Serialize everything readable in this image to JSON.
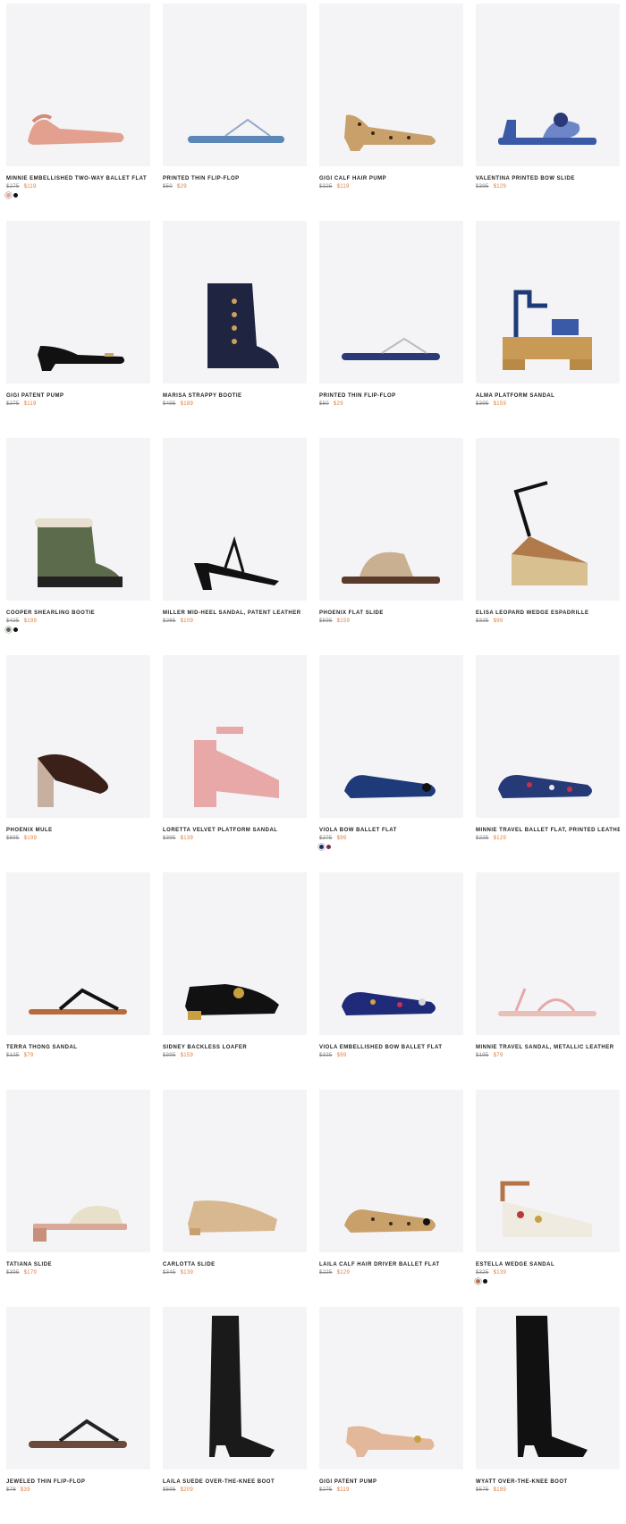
{
  "colors": {
    "sale_price": "#e07d3a",
    "original_price": "#888888",
    "tile_background": "#f4f4f6"
  },
  "products": [
    {
      "name": "MINNIE EMBELLISHED TWO-WAY BALLET FLAT",
      "original_price": "$275",
      "sale_price": "$119",
      "swatches": [
        "#e9a593",
        "#111111"
      ],
      "icon": "pink-ballet-flat-image"
    },
    {
      "name": "PRINTED THIN FLIP-FLOP",
      "original_price": "$50",
      "sale_price": "$29",
      "swatches": [],
      "icon": "blue-flip-flop-image"
    },
    {
      "name": "GIGI CALF HAIR PUMP",
      "original_price": "$325",
      "sale_price": "$119",
      "swatches": [],
      "icon": "leopard-pump-image"
    },
    {
      "name": "VALENTINA PRINTED BOW SLIDE",
      "original_price": "$395",
      "sale_price": "$129",
      "swatches": [],
      "icon": "printed-bow-slide-image"
    },
    {
      "name": "GIGI PATENT PUMP",
      "original_price": "$275",
      "sale_price": "$119",
      "swatches": [],
      "icon": "black-patent-pump-image"
    },
    {
      "name": "MARISA STRAPPY BOOTIE",
      "original_price": "$495",
      "sale_price": "$189",
      "swatches": [],
      "icon": "navy-strappy-bootie-image"
    },
    {
      "name": "PRINTED THIN FLIP-FLOP",
      "original_price": "$50",
      "sale_price": "$29",
      "swatches": [],
      "icon": "navy-flip-flop-image"
    },
    {
      "name": "ALMA PLATFORM SANDAL",
      "original_price": "$395",
      "sale_price": "$159",
      "swatches": [],
      "icon": "wood-platform-sandal-image"
    },
    {
      "name": "COOPER SHEARLING BOOTIE",
      "original_price": "$425",
      "sale_price": "$199",
      "swatches": [
        "#556b4e",
        "#111111"
      ],
      "icon": "green-shearling-bootie-image"
    },
    {
      "name": "MILLER MID-HEEL SANDAL, PATENT LEATHER",
      "original_price": "$265",
      "sale_price": "$109",
      "swatches": [],
      "icon": "black-mid-heel-sandal-image"
    },
    {
      "name": "PHOENIX FLAT SLIDE",
      "original_price": "$595",
      "sale_price": "$159",
      "swatches": [],
      "icon": "fur-flat-slide-image"
    },
    {
      "name": "ELISA LEOPARD WEDGE ESPADRILLE",
      "original_price": "$325",
      "sale_price": "$99",
      "swatches": [],
      "icon": "leopard-wedge-espadrille-image"
    },
    {
      "name": "PHOENIX MULE",
      "original_price": "$695",
      "sale_price": "$199",
      "swatches": [],
      "icon": "brown-mule-image"
    },
    {
      "name": "LORETTA VELVET PLATFORM SANDAL",
      "original_price": "$395",
      "sale_price": "$139",
      "swatches": [],
      "icon": "pink-velvet-platform-image"
    },
    {
      "name": "VIOLA BOW BALLET FLAT",
      "original_price": "$275",
      "sale_price": "$99",
      "swatches": [
        "#1e2a66",
        "#7d2a52"
      ],
      "icon": "navy-bow-ballet-flat-image"
    },
    {
      "name": "MINNIE TRAVEL BALLET FLAT, PRINTED LEATHER",
      "original_price": "$225",
      "sale_price": "$129",
      "swatches": [],
      "icon": "printed-travel-ballet-flat-image"
    },
    {
      "name": "TERRA THONG SANDAL",
      "original_price": "$125",
      "sale_price": "$79",
      "swatches": [],
      "icon": "thong-sandal-image"
    },
    {
      "name": "SIDNEY BACKLESS LOAFER",
      "original_price": "$395",
      "sale_price": "$159",
      "swatches": [],
      "icon": "black-backless-loafer-image"
    },
    {
      "name": "VIOLA EMBELLISHED BOW BALLET FLAT",
      "original_price": "$325",
      "sale_price": "$99",
      "swatches": [],
      "icon": "embellished-ballet-flat-image"
    },
    {
      "name": "MINNIE TRAVEL SANDAL, METALLIC LEATHER",
      "original_price": "$195",
      "sale_price": "$79",
      "swatches": [],
      "icon": "metallic-travel-sandal-image"
    },
    {
      "name": "TATIANA SLIDE",
      "original_price": "$395",
      "sale_price": "$179",
      "swatches": [],
      "icon": "woven-slide-image"
    },
    {
      "name": "CARLOTTA SLIDE",
      "original_price": "$345",
      "sale_price": "$139",
      "swatches": [],
      "icon": "brocade-slide-image"
    },
    {
      "name": "LAILA CALF HAIR DRIVER BALLET FLAT",
      "original_price": "$225",
      "sale_price": "$129",
      "swatches": [],
      "icon": "leopard-driver-flat-image"
    },
    {
      "name": "ESTELLA WEDGE SANDAL",
      "original_price": "$325",
      "sale_price": "$139",
      "swatches": [
        "#b5734a",
        "#111111"
      ],
      "icon": "studded-wedge-sandal-image"
    },
    {
      "name": "JEWELED THIN FLIP-FLOP",
      "original_price": "$78",
      "sale_price": "$39",
      "swatches": [],
      "icon": "jeweled-flip-flop-image"
    },
    {
      "name": "LAILA SUEDE OVER-THE-KNEE BOOT",
      "original_price": "$595",
      "sale_price": "$209",
      "swatches": [],
      "icon": "black-suede-otk-boot-image"
    },
    {
      "name": "GIGI PATENT PUMP",
      "original_price": "$275",
      "sale_price": "$119",
      "swatches": [],
      "icon": "nude-patent-pump-image"
    },
    {
      "name": "WYATT OVER-THE-KNEE BOOT",
      "original_price": "$575",
      "sale_price": "$189",
      "swatches": [],
      "icon": "black-otk-boot-image"
    }
  ]
}
